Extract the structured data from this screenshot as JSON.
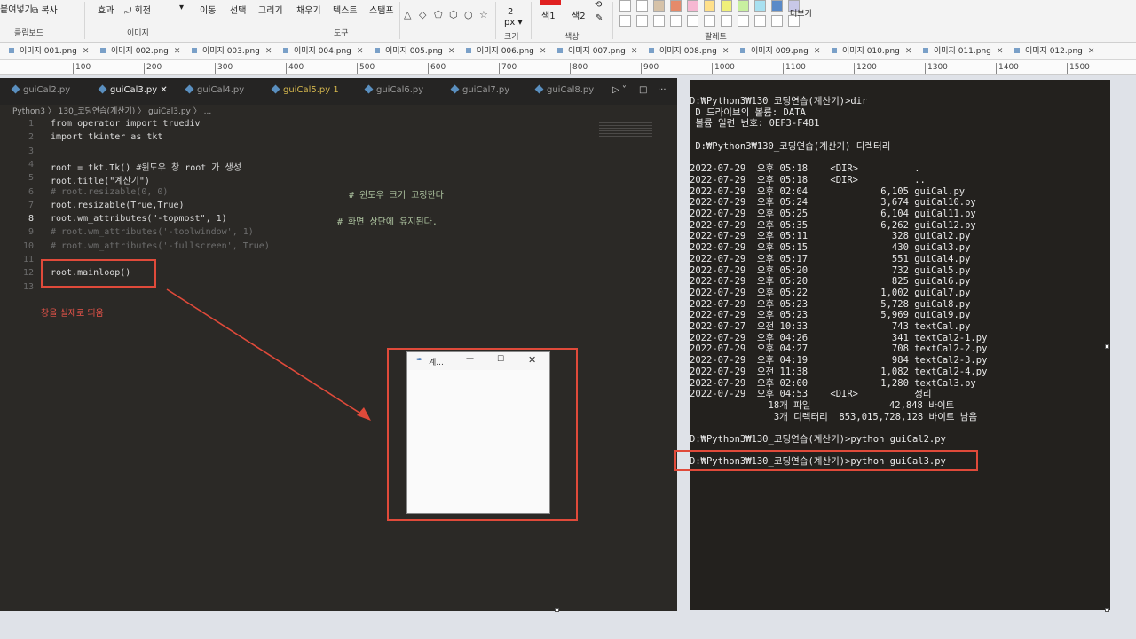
{
  "ribbon": {
    "clipboard_paste": "붙여넣기",
    "copy": "복사",
    "clipboard_group": "클립보드",
    "effect": "효과",
    "rotate": "회전",
    "image_group": "이미지",
    "move": "이동",
    "select": "선택",
    "draw": "그리기",
    "fill": "채우기",
    "text": "텍스트",
    "stamp": "스탬프",
    "tools_group": "도구",
    "size_value": "2",
    "size_unit": "px",
    "size_group": "크기",
    "color1": "색1",
    "color2": "색2",
    "color_group": "색상",
    "palette_group": "팔레트",
    "more": "더보기",
    "palette_colors": [
      "#ffffff",
      "#ffffff",
      "#d6c2a8",
      "#e58a6a",
      "#f6b8d2",
      "#ffe08a",
      "#f0f07a",
      "#c8f0a0",
      "#a8e0f0",
      "#5a8ac8",
      "#c8c8e8"
    ]
  },
  "image_tabs": [
    "이미지 001.png",
    "이미지 002.png",
    "이미지 003.png",
    "이미지 004.png",
    "이미지 005.png",
    "이미지 006.png",
    "이미지 007.png",
    "이미지 008.png",
    "이미지 009.png",
    "이미지 010.png",
    "이미지 011.png",
    "이미지 012.png"
  ],
  "ruler_ticks": [
    "100",
    "200",
    "300",
    "400",
    "500",
    "600",
    "700",
    "800",
    "900",
    "1000",
    "1100",
    "1200",
    "1300",
    "1400",
    "1500"
  ],
  "editor": {
    "tabs": [
      {
        "label": "guiCal2.py",
        "state": "normal"
      },
      {
        "label": "guiCal3.py",
        "state": "active"
      },
      {
        "label": "guiCal4.py",
        "state": "normal"
      },
      {
        "label": "guiCal5.py 1",
        "state": "warn"
      },
      {
        "label": "guiCal6.py",
        "state": "normal"
      },
      {
        "label": "guiCal7.py",
        "state": "normal"
      },
      {
        "label": "guiCal8.py",
        "state": "normal"
      }
    ],
    "breadcrumb": "Python3 〉 130_코딩연습(계산기) 〉 guiCal3.py 〉 ...",
    "lines": [
      {
        "num": "1",
        "text": "from operator import truediv",
        "kind": "plain"
      },
      {
        "num": "2",
        "text": "import tkinter as tkt",
        "kind": "plain"
      },
      {
        "num": "3",
        "text": "",
        "kind": "plain"
      },
      {
        "num": "4",
        "text": "root = tkt.Tk() #윈도우 창 root 가 생성",
        "kind": "plain"
      },
      {
        "num": "5",
        "text": "root.title(\"계산기\")",
        "kind": "plain"
      },
      {
        "num": "6",
        "text": "# root.resizable(0, 0)",
        "kind": "comment"
      },
      {
        "num": "7",
        "text": "root.resizable(True,True)",
        "kind": "plain"
      },
      {
        "num": "8",
        "text": "root.wm_attributes(\"-topmost\", 1)",
        "kind": "plain"
      },
      {
        "num": "9",
        "text": "# root.wm_attributes('-toolwindow', 1)",
        "kind": "comment"
      },
      {
        "num": "10",
        "text": "# root.wm_attributes('-fullscreen', True)",
        "kind": "comment"
      },
      {
        "num": "11",
        "text": "",
        "kind": "plain"
      },
      {
        "num": "12",
        "text": "root.mainloop()",
        "kind": "plain"
      },
      {
        "num": "13",
        "text": "",
        "kind": "plain"
      }
    ],
    "comment_resize": "# 윈도우 크기 고정한다",
    "comment_topmost": "# 화면 상단에 유지된다.",
    "annotation": "창을 실제로 띄움",
    "tk_title": "계..."
  },
  "terminal": {
    "lines": [
      "D:₩Python3₩130_코딩연습(계산기)>dir",
      " D 드라이브의 볼륨: DATA",
      " 볼륨 일련 번호: 0EF3-F481",
      "",
      " D:₩Python3₩130_코딩연습(계산기) 디렉터리",
      "",
      "2022-07-29  오후 05:18    <DIR>          .",
      "2022-07-29  오후 05:18    <DIR>          ..",
      "2022-07-29  오후 02:04             6,105 guiCal.py",
      "2022-07-29  오후 05:24             3,674 guiCal10.py",
      "2022-07-29  오후 05:25             6,104 guiCal11.py",
      "2022-07-29  오후 05:35             6,262 guiCal12.py",
      "2022-07-29  오후 05:11               328 guiCal2.py",
      "2022-07-29  오후 05:15               430 guiCal3.py",
      "2022-07-29  오후 05:17               551 guiCal4.py",
      "2022-07-29  오후 05:20               732 guiCal5.py",
      "2022-07-29  오후 05:20               825 guiCal6.py",
      "2022-07-29  오후 05:22             1,002 guiCal7.py",
      "2022-07-29  오후 05:23             5,728 guiCal8.py",
      "2022-07-29  오후 05:23             5,969 guiCal9.py",
      "2022-07-27  오전 10:33               743 textCal.py",
      "2022-07-29  오후 04:26               341 textCal2-1.py",
      "2022-07-29  오후 04:27               708 textCal2-2.py",
      "2022-07-29  오후 04:19               984 textCal2-3.py",
      "2022-07-29  오전 11:38             1,082 textCal2-4.py",
      "2022-07-29  오후 02:00             1,280 textCal3.py",
      "2022-07-29  오후 04:53    <DIR>          정리",
      "              18개 파일              42,848 바이트",
      "               3개 디렉터리  853,015,728,128 바이트 남음",
      "",
      "D:₩Python3₩130_코딩연습(계산기)>python guiCal2.py",
      "",
      "D:₩Python3₩130_코딩연습(계산기)>python guiCal3.py"
    ]
  }
}
